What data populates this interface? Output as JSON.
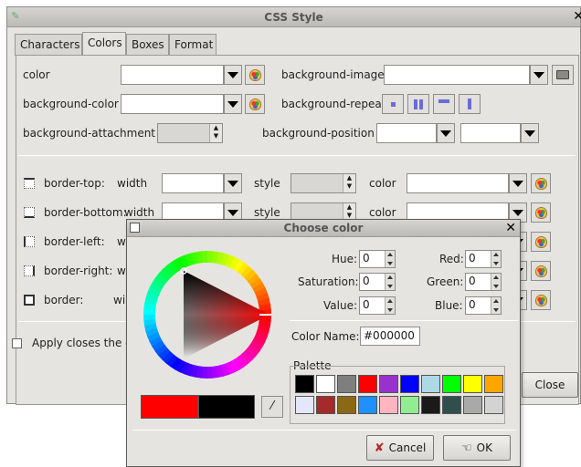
{
  "main_window": {
    "title": "CSS Style",
    "close_glyph": "✕",
    "tabs": [
      {
        "label": "Characters"
      },
      {
        "label": "Colors"
      },
      {
        "label": "Boxes"
      },
      {
        "label": "Format"
      }
    ],
    "active_tab": "Colors",
    "colors_section": {
      "color_label": "color",
      "background_color_label": "background-color",
      "background_attachment_label": "background-attachment",
      "background_image_label": "background-image",
      "background_repeat_label": "background-repeat",
      "background_position_label": "background-position"
    },
    "border_rows": [
      {
        "label": "border-top:",
        "width_label": "width",
        "style_label": "style",
        "color_label": "color"
      },
      {
        "label": "border-bottom:",
        "width_label": "width",
        "style_label": "style",
        "color_label": "color"
      },
      {
        "label": "border-left:",
        "width_label": "wi"
      },
      {
        "label": "border-right:",
        "width_label": "w"
      },
      {
        "label": "border:",
        "width_label": "wi"
      }
    ],
    "apply_checkbox_label": "Apply closes the d",
    "close_button": "Close"
  },
  "dialog": {
    "title": "Choose color",
    "close_glyph": "✕",
    "hue": {
      "label": "Hue:",
      "value": "0"
    },
    "saturation": {
      "label": "Saturation:",
      "value": "0"
    },
    "value_field": {
      "label": "Value:",
      "value": "0"
    },
    "red": {
      "label": "Red:",
      "value": "0"
    },
    "green": {
      "label": "Green:",
      "value": "0"
    },
    "blue": {
      "label": "Blue:",
      "value": "0"
    },
    "color_name_label": "Color Name:",
    "color_name_value": "#000000",
    "palette_label": "Palette",
    "palette_row1": [
      "#000000",
      "#ffffff",
      "#7f7f7f",
      "#ff0000",
      "#9932cc",
      "#0000ff",
      "#add8e6",
      "#00ff00",
      "#ffff00",
      "#ffa500"
    ],
    "palette_row2": [
      "#e6e6fa",
      "#a52a2a",
      "#8b6914",
      "#1e90ff",
      "#ffb6c1",
      "#90ee90",
      "#1a1a1a",
      "#2f4f4f",
      "#a9a9a9",
      "#d3d3d3"
    ],
    "current_color": "#ff0000",
    "previous_color": "#000000",
    "cancel_button": "Cancel",
    "ok_button": "OK"
  }
}
